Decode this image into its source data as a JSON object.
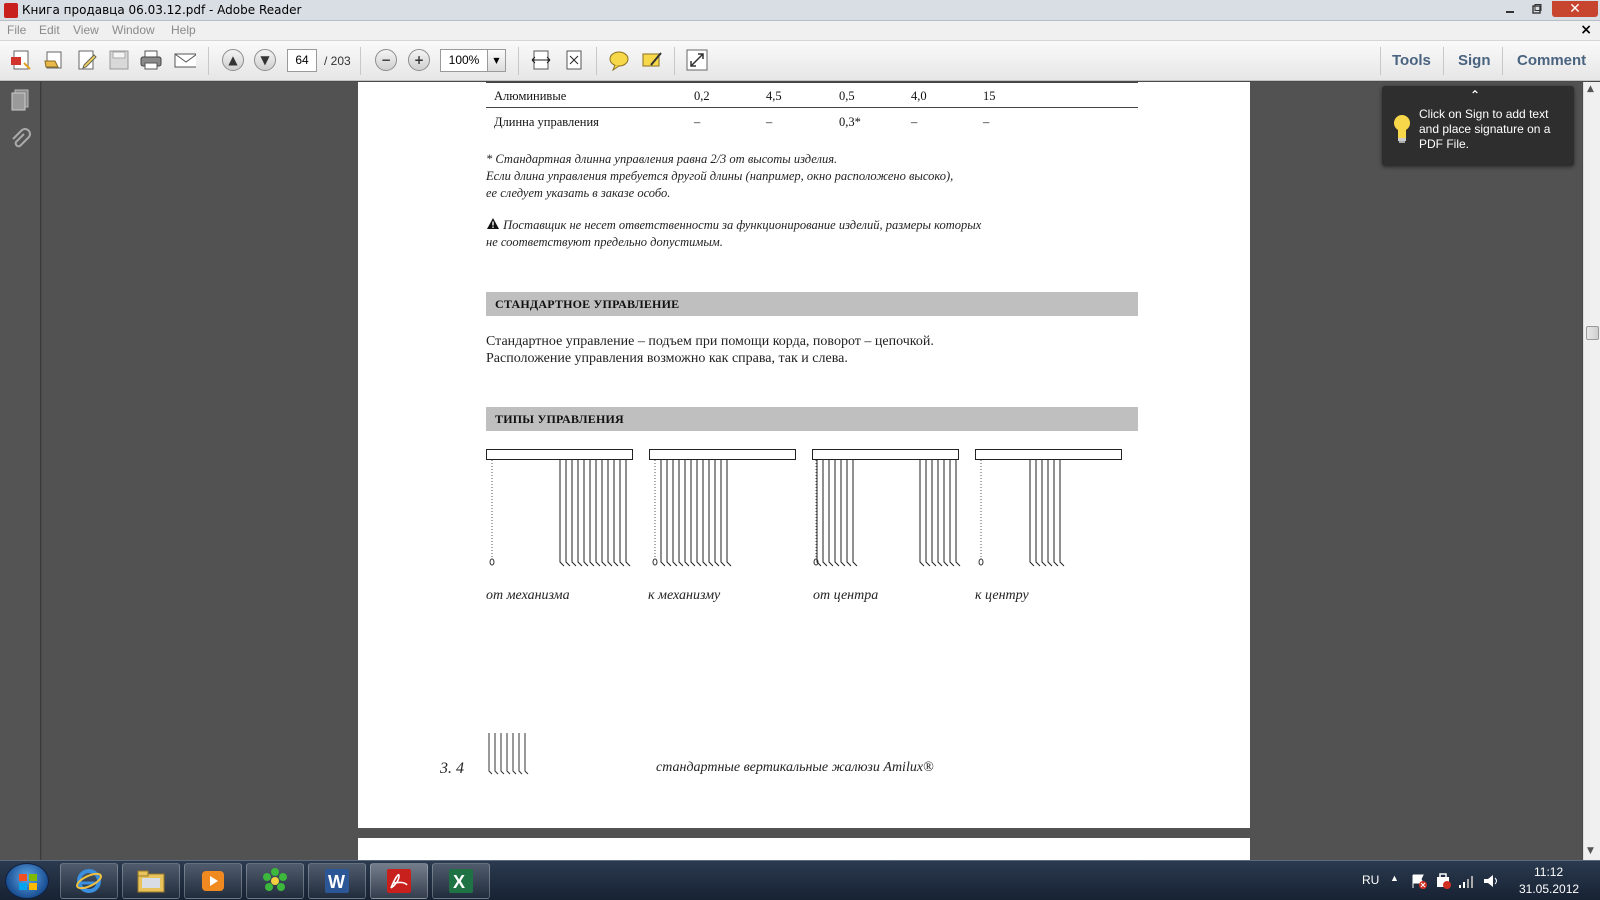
{
  "window": {
    "title": "Книга продавца 06.03.12.pdf - Adobe Reader",
    "minimize_icon": "minimize-icon",
    "maximize_icon": "maximize-icon",
    "close_label": "✕"
  },
  "menubar": {
    "items": [
      "File",
      "Edit",
      "View",
      "Window",
      "Help"
    ],
    "close_doc": "×"
  },
  "toolbar": {
    "current_page": "64",
    "total_pages": "/ 203",
    "zoom": "100%",
    "links": [
      "Tools",
      "Sign",
      "Comment"
    ]
  },
  "document": {
    "table": [
      {
        "name": "Алюминивые",
        "values": [
          "0,2",
          "4,5",
          "0,5",
          "4,0",
          "15"
        ]
      },
      {
        "name": "Длинна управления",
        "values": [
          "–",
          "–",
          "0,3*",
          "–",
          "–"
        ]
      }
    ],
    "footnote_lines": [
      "* Стандартная длинна управления равна 2/3 от высоты изделия.",
      "Если длина управления требуется другой длины (например, окно расположено высоко),",
      "ее следует указать в заказе особо."
    ],
    "warning_lines": [
      "Поставщик не несет ответственности за функционирование изделий, размеры которых",
      "не соответствуют предельно допустимым."
    ],
    "section1_title": "СТАНДАРТНОЕ УПРАВЛЕНИЕ",
    "section1_lines": [
      "Стандартное управление – подъем при помощи корда, поворот – цепочкой.",
      "Расположение управления возможно как справа, так и слева."
    ],
    "section2_title": "ТИПЫ УПРАВЛЕНИЯ",
    "captions": [
      "от механизма",
      "к механизму",
      "от центра",
      "к центру"
    ],
    "page_number": "3. 4",
    "footer": "стандартные вертикальные жалюзи Amilux®"
  },
  "tooltip": {
    "text": "Click on Sign to add text and place signature on a PDF File."
  },
  "taskbar": {
    "lang": "RU",
    "time": "11:12",
    "date": "31.05.2012"
  },
  "colors": {
    "accent_link": "#4a6380",
    "section_bar": "#bfbfbf",
    "doc_bg": "#525252"
  }
}
